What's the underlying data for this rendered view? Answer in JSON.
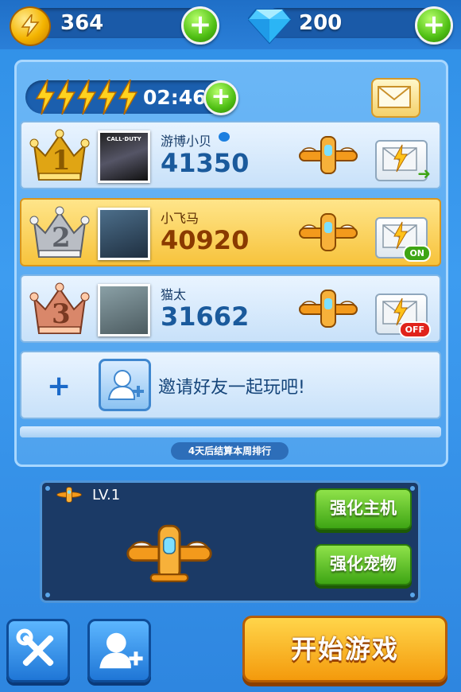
{
  "top_bar": {
    "coins": "364",
    "gems": "200",
    "coin_icon": "gold-coin-icon",
    "gem_icon": "blue-diamond-icon"
  },
  "energy": {
    "bolts": 5,
    "timer": "02:46"
  },
  "leaderboard": [
    {
      "rank": "1",
      "name": "游博小贝",
      "score": "41350",
      "crown": "gold",
      "mail_tag": ""
    },
    {
      "rank": "2",
      "name": "小飞马",
      "score": "40920",
      "crown": "silver",
      "mail_tag": "ON"
    },
    {
      "rank": "3",
      "name": "猫太",
      "score": "31662",
      "crown": "bronze",
      "mail_tag": "OFF"
    }
  ],
  "avatar1_text": "CALL·DUTY",
  "invite": {
    "plus": "+",
    "text": "邀请好友一起玩吧!"
  },
  "footnote": "4天后结算本周排行",
  "plane_panel": {
    "level": "LV.1",
    "upgrade_main": "强化主机",
    "upgrade_pet": "强化宠物"
  },
  "start_button": "开始游戏",
  "colors": {
    "accent_green": "#4fbf14",
    "gold": "#f7c33c",
    "panel_blue": "#4ea2ee",
    "on": "#3ea514",
    "off": "#e0231b"
  }
}
